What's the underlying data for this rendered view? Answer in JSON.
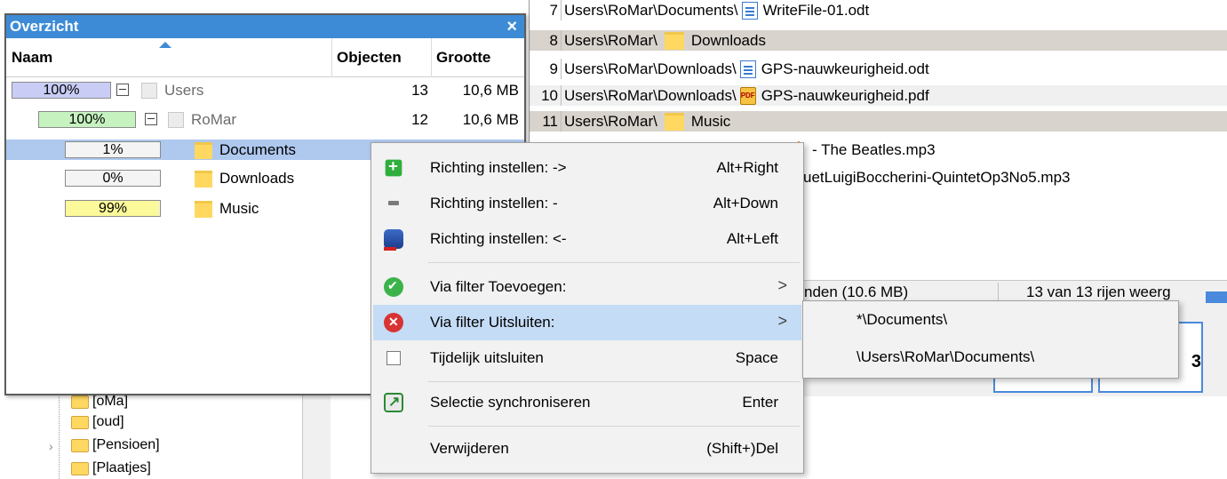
{
  "file_list": {
    "rows": [
      {
        "num": "7",
        "path": "Users\\RoMar\\Documents\\",
        "icon": "document-icon",
        "name": "WriteFile-01.odt",
        "kind": "file"
      },
      {
        "num": "8",
        "path": "Users\\RoMar\\",
        "icon": "folder-icon",
        "name": "Downloads",
        "kind": "folder"
      },
      {
        "num": "9",
        "path": "Users\\RoMar\\Downloads\\",
        "icon": "document-icon",
        "name": "GPS-nauwkeurigheid.odt",
        "kind": "file"
      },
      {
        "num": "10",
        "path": "Users\\RoMar\\Downloads\\",
        "icon": "pdf-icon",
        "name": "GPS-nauwkeurigheid.pdf",
        "kind": "file"
      },
      {
        "num": "11",
        "path": "Users\\RoMar\\",
        "icon": "folder-icon",
        "name": "Music",
        "kind": "folder"
      },
      {
        "num": "",
        "path": "",
        "icon": "audio-icon",
        "name": "- The Beatles.mp3",
        "kind": "file"
      },
      {
        "num": "",
        "path": "",
        "icon": "",
        "name": "uetLuigiBoccherini-QuintetOp3No5.mp3",
        "kind": "file"
      }
    ]
  },
  "status": {
    "found": "nden (10.6 MB)",
    "rows": "13 van 13 rijen weerg"
  },
  "page_control": {
    "number": "3"
  },
  "tree": {
    "items": [
      "[oMa]",
      "[oud]",
      "[Pensioen]",
      "[Plaatjes]"
    ]
  },
  "overview": {
    "title": "Overzicht",
    "close": "×",
    "headers": {
      "name": "Naam",
      "objects": "Objecten",
      "size": "Grootte"
    },
    "rows": [
      {
        "pct": "100%",
        "pct_value": 1.0,
        "fill": "#c9cdf5",
        "name": "Users",
        "objects": "13",
        "size": "10,6 MB"
      },
      {
        "pct": "100%",
        "pct_value": 1.0,
        "fill": "#c6f2c0",
        "name": "RoMar",
        "objects": "12",
        "size": "10,6 MB"
      },
      {
        "pct": "1%",
        "pct_value": 0.01,
        "fill": "#f3f3f3",
        "name": "Documents",
        "objects": "",
        "size": ""
      },
      {
        "pct": "0%",
        "pct_value": 0.0,
        "fill": "#f3f3f3",
        "name": "Downloads",
        "objects": "",
        "size": ""
      },
      {
        "pct": "99%",
        "pct_value": 0.99,
        "fill": "#fbf99a",
        "name": "Music",
        "objects": "",
        "size": ""
      }
    ]
  },
  "context_menu": {
    "items": [
      {
        "label": "Richting instellen: ->",
        "shortcut": "Alt+Right",
        "icon": "add-icon"
      },
      {
        "label": "Richting instellen: -",
        "shortcut": "Alt+Down",
        "icon": "minus-icon"
      },
      {
        "label": "Richting instellen: <-",
        "shortcut": "Alt+Left",
        "icon": "database-icon"
      },
      {
        "label": "Via filter Toevoegen:",
        "shortcut": "",
        "icon": "check-icon",
        "arrow": ">"
      },
      {
        "label": "Via filter Uitsluiten:",
        "shortcut": "",
        "icon": "exclude-icon",
        "arrow": ">"
      },
      {
        "label": "Tijdelijk uitsluiten",
        "shortcut": "Space",
        "icon": "checkbox-icon"
      },
      {
        "label": "Selectie synchroniseren",
        "shortcut": "Enter",
        "icon": "sync-icon"
      },
      {
        "label": "Verwijderen",
        "shortcut": "(Shift+)Del",
        "icon": ""
      }
    ]
  },
  "submenu": {
    "items": [
      "*\\Documents\\",
      "\\Users\\RoMar\\Documents\\"
    ]
  }
}
